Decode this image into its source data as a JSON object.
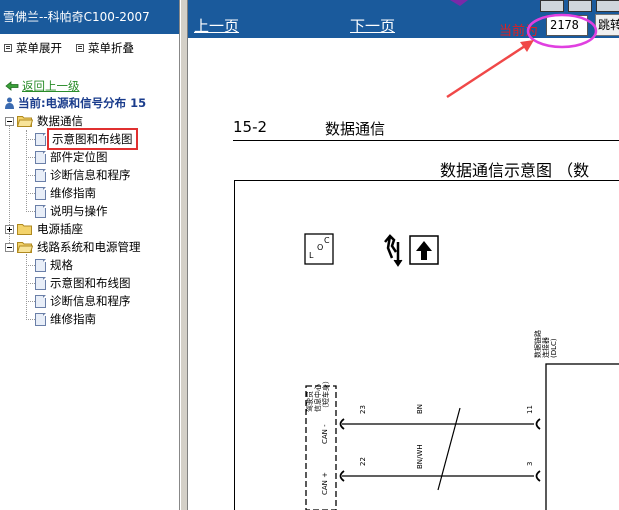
{
  "sidebar": {
    "title": "雪佛兰--科帕奇C100-2007",
    "expand_all": "菜单展开",
    "collapse_all": "菜单折叠",
    "back": "返回上一级",
    "current": "当前:电源和信号分布 15",
    "tree": {
      "data_comm": "数据通信",
      "data_comm_items": [
        "示意图和布线图",
        "部件定位图",
        "诊断信息和程序",
        "维修指南",
        "说明与操作"
      ],
      "power_socket": "电源插座",
      "wiring": "线路系统和电源管理",
      "wiring_items": [
        "规格",
        "示意图和布线图",
        "诊断信息和程序",
        "维修指南"
      ]
    }
  },
  "nav": {
    "prev": "上一页",
    "next": "下一页",
    "current_label": "当前为",
    "page_value": "2178",
    "jump": "跳转"
  },
  "document": {
    "section_number": "15-2",
    "section_title": "数据通信",
    "diagram_title": "数据通信示意图 （数",
    "left_module": "驾驶员\n信息中心\n（短车身）",
    "right_module": "数据链路\n连接器\n(DLC)",
    "pin_left_top": "23",
    "pin_left_bottom": "22",
    "pin_right_top": "11",
    "pin_right_bottom": "3",
    "can_minus": "CAN -",
    "can_plus": "CAN +",
    "wire_top": "BN",
    "wire_bottom": "BN/WH",
    "bottom_left_char": "线"
  },
  "colors": {
    "header_blue": "#1a5a9c",
    "link_green": "#2a8c2a",
    "current_blue": "#1a3c8c",
    "highlight_red": "#e03030",
    "annotation_magenta": "#e040e0",
    "annotation_arrow": "#f04848"
  }
}
